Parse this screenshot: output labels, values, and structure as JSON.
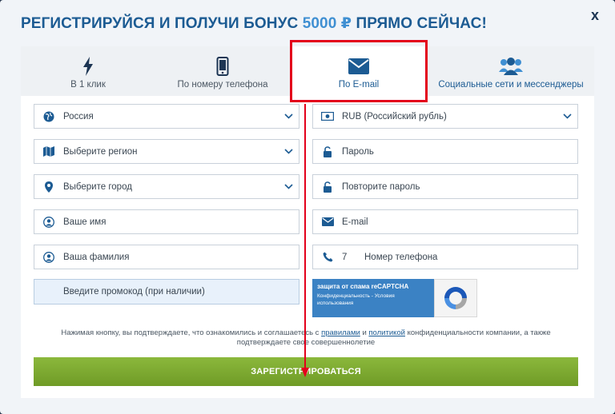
{
  "title": {
    "main": "РЕГИСТРИРУЙСЯ И ПОЛУЧИ БОНУС ",
    "bonus": "5000 ₽",
    "tail": " ПРЯМО СЕЙЧАС!"
  },
  "close_label": "x",
  "tabs": [
    {
      "label": "В 1 клик",
      "icon": "lightning-icon"
    },
    {
      "label": "По номеру телефона",
      "icon": "phone-icon"
    },
    {
      "label": "По E-mail",
      "icon": "envelope-icon"
    },
    {
      "label": "Социальные сети и мессенджеры",
      "icon": "users-icon"
    }
  ],
  "left_fields": {
    "country": "Россия",
    "region": "Выберите регион",
    "city": "Выберите город",
    "first_name": "Ваше имя",
    "last_name": "Ваша фамилия",
    "promo": "Введите промокод (при наличии)"
  },
  "right_fields": {
    "currency": "RUB (Российский рубль)",
    "password": "Пароль",
    "password_repeat": "Повторите пароль",
    "email": "E-mail",
    "phone_code": "7",
    "phone": "Номер телефона"
  },
  "captcha": {
    "title": "защита от спама reCAPTCHA",
    "subtitle": "Конфиденциальность - Условия использования"
  },
  "terms": {
    "part1": "Нажимая кнопку, вы подтверждаете, что ознакомились и соглашаетесь с ",
    "link_rules": "правилами",
    "part2": " и ",
    "link_policy": "политикой",
    "part3": " конфиденциальности компании, а также подтверждаете свое совершеннолетие"
  },
  "submit_label": "ЗАРЕГИСТРИРОВАТЬСЯ",
  "colors": {
    "accent": "#1c5b93",
    "highlight": "#e3001b",
    "submit": "#7aa62e"
  }
}
